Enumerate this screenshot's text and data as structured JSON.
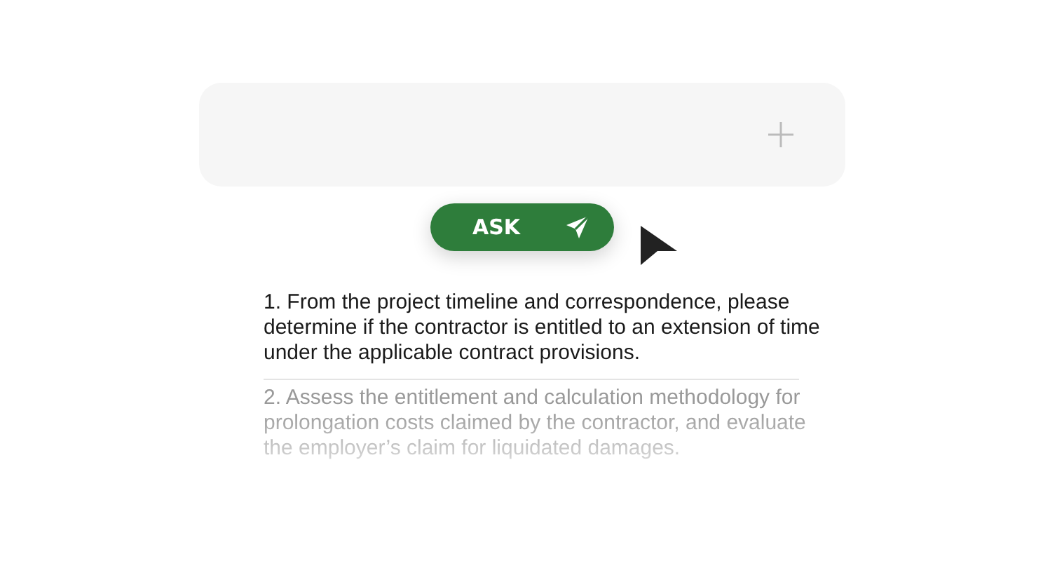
{
  "ask_button": {
    "label": "ASK"
  },
  "suggestions": [
    {
      "text": "1. From the project timeline and correspondence, please determine if the contractor is entitled to an extension of time under the applicable contract provisions.",
      "dimmed": false
    },
    {
      "text": "2. Assess the entitlement and calculation methodology for prolongation costs claimed by the contractor, and evaluate the employer’s claim for liquidated damages.",
      "dimmed": true
    }
  ]
}
